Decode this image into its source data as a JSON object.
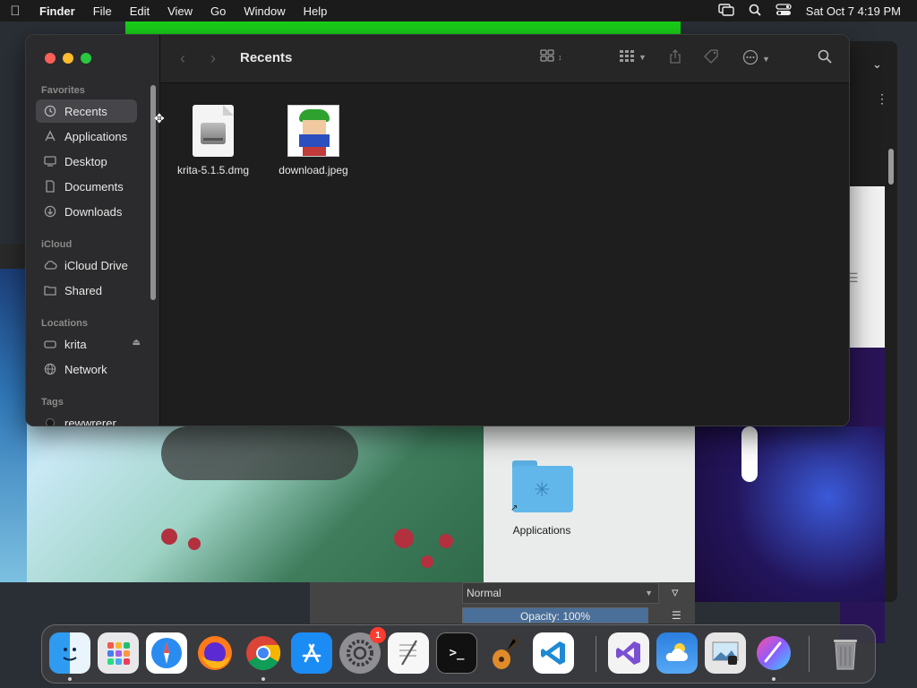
{
  "menubar": {
    "apple_icon": "apple-logo-icon",
    "app_name": "Finder",
    "menus": [
      "File",
      "Edit",
      "View",
      "Go",
      "Window",
      "Help"
    ],
    "clock": "Sat Oct 7  4:19 PM",
    "status_icons": [
      "screen-mirroring-icon",
      "spotlight-search-icon",
      "control-center-icon"
    ]
  },
  "finder": {
    "title": "Recents",
    "sidebar": {
      "favorites_header": "Favorites",
      "favorites": [
        {
          "label": "Recents",
          "icon": "clock-icon",
          "active": true
        },
        {
          "label": "Applications",
          "icon": "applications-icon"
        },
        {
          "label": "Desktop",
          "icon": "desktop-icon"
        },
        {
          "label": "Documents",
          "icon": "document-icon"
        },
        {
          "label": "Downloads",
          "icon": "downloads-icon"
        }
      ],
      "icloud_header": "iCloud",
      "icloud": [
        {
          "label": "iCloud Drive",
          "icon": "cloud-icon"
        },
        {
          "label": "Shared",
          "icon": "shared-folder-icon"
        }
      ],
      "locations_header": "Locations",
      "locations": [
        {
          "label": "krita",
          "icon": "drive-icon",
          "eject": "eject-icon"
        },
        {
          "label": "Network",
          "icon": "network-icon"
        }
      ],
      "tags_header": "Tags",
      "tags": [
        {
          "label": "rewwrerer",
          "color": "#1a1a1a"
        }
      ]
    },
    "files": [
      {
        "name": "krita-5.1.5.dmg",
        "icon": "disk-image-icon"
      },
      {
        "name": "download.jpeg",
        "icon": "image-thumbnail-icon"
      }
    ]
  },
  "desktop": {
    "folder_label": "Applications"
  },
  "krita_panel": {
    "blend_mode": "Normal",
    "opacity": "Opacity:  100%"
  },
  "dock": {
    "items": [
      {
        "name": "Finder",
        "icon": "finder-icon",
        "running": true
      },
      {
        "name": "Launchpad",
        "icon": "launchpad-icon"
      },
      {
        "name": "Safari",
        "icon": "safari-icon"
      },
      {
        "name": "Firefox",
        "icon": "firefox-icon"
      },
      {
        "name": "Google Chrome",
        "icon": "chrome-icon",
        "running": true
      },
      {
        "name": "App Store",
        "icon": "app-store-icon"
      },
      {
        "name": "System Settings",
        "icon": "settings-icon",
        "badge": "1"
      },
      {
        "name": "TextEdit",
        "icon": "textedit-icon"
      },
      {
        "name": "Terminal",
        "icon": "terminal-icon"
      },
      {
        "name": "GarageBand",
        "icon": "guitar-icon"
      },
      {
        "name": "Visual Studio Code",
        "icon": "vscode-icon"
      },
      {
        "name": "Visual Studio",
        "icon": "visual-studio-icon"
      },
      {
        "name": "Weather",
        "icon": "weather-icon"
      },
      {
        "name": "Preview",
        "icon": "preview-icon"
      },
      {
        "name": "Krita",
        "icon": "krita-icon",
        "running": true
      },
      {
        "name": "Trash",
        "icon": "trash-icon"
      }
    ]
  }
}
